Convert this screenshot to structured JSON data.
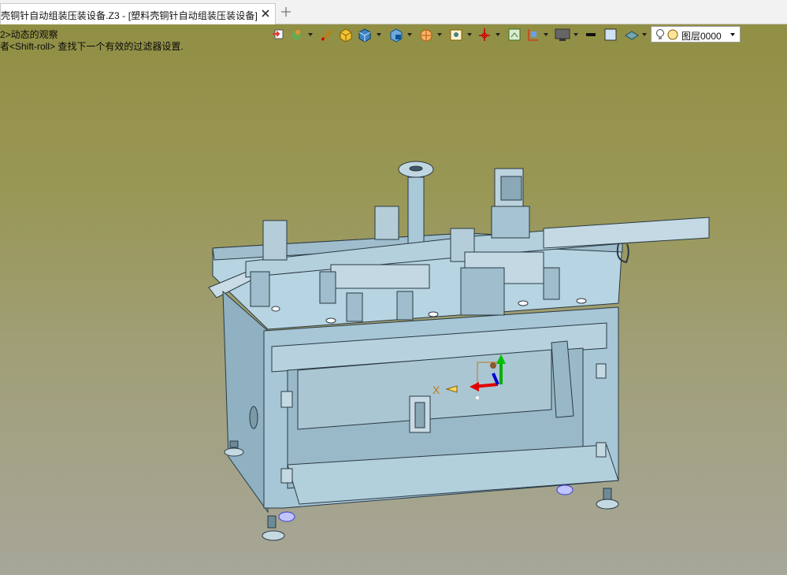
{
  "tab": {
    "title": "壳铜针自动组装压装设备.Z3 - [塑料壳铜针自动组装压装设备]",
    "close_icon": "close-icon",
    "add_icon": "plus-icon"
  },
  "prompt": {
    "line1": "2>动态的观察",
    "line2": "者<Shift-roll> 查找下一个有效的过滤器设置."
  },
  "toolbar": {
    "icons": [
      "exit-icon",
      "color-icon",
      "pen-icon",
      "cube-yellow-icon",
      "cube-blue-icon",
      "cube-shaded-icon",
      "render-style-icon",
      "view-icon",
      "axis-icon",
      "frame-icon",
      "section-icon",
      "display-icon",
      "line-style-icon",
      "color-swatch-icon",
      "layer-material-icon"
    ],
    "layer": {
      "name": "图层0000",
      "bulb_icon": "bulb-icon",
      "status_icon": "layer-status-icon"
    }
  },
  "axis": {
    "x_label": "X"
  }
}
